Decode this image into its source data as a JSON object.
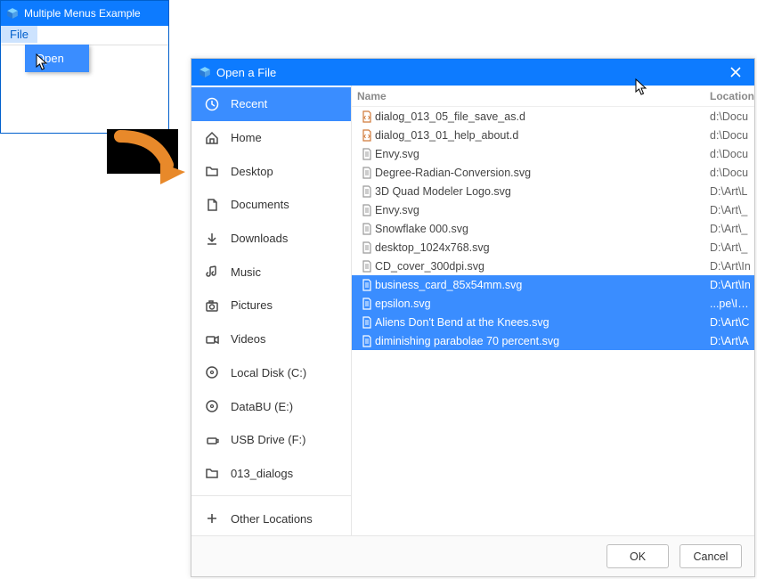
{
  "app": {
    "title": "Multiple Menus Example",
    "menu_file": "File",
    "menu_open": "Open"
  },
  "dialog": {
    "title": "Open a File",
    "header": {
      "name": "Name",
      "location": "Location"
    },
    "sidebar": [
      {
        "label": "Recent",
        "icon": "clock-icon",
        "selected": true
      },
      {
        "label": "Home",
        "icon": "home-icon",
        "selected": false
      },
      {
        "label": "Desktop",
        "icon": "folder-icon",
        "selected": false
      },
      {
        "label": "Documents",
        "icon": "document-icon",
        "selected": false
      },
      {
        "label": "Downloads",
        "icon": "download-icon",
        "selected": false
      },
      {
        "label": "Music",
        "icon": "music-icon",
        "selected": false
      },
      {
        "label": "Pictures",
        "icon": "camera-icon",
        "selected": false
      },
      {
        "label": "Videos",
        "icon": "video-icon",
        "selected": false
      },
      {
        "label": "Local Disk (C:)",
        "icon": "disk-icon",
        "selected": false
      },
      {
        "label": "DataBU (E:)",
        "icon": "disk-icon",
        "selected": false
      },
      {
        "label": "USB Drive (F:)",
        "icon": "usb-icon",
        "selected": false
      },
      {
        "label": "013_dialogs",
        "icon": "folder-icon",
        "selected": false
      }
    ],
    "other_locations": "Other Locations",
    "files": [
      {
        "name": "dialog_013_05_file_save_as.d",
        "location": "d:\\Docu",
        "selected": false,
        "kind": "code"
      },
      {
        "name": "dialog_013_01_help_about.d",
        "location": "d:\\Docu",
        "selected": false,
        "kind": "code"
      },
      {
        "name": "Envy.svg",
        "location": "d:\\Docu",
        "selected": false,
        "kind": "doc"
      },
      {
        "name": "Degree-Radian-Conversion.svg",
        "location": "d:\\Docu",
        "selected": false,
        "kind": "doc"
      },
      {
        "name": "3D Quad Modeler Logo.svg",
        "location": "D:\\Art\\L",
        "selected": false,
        "kind": "doc"
      },
      {
        "name": "Envy.svg",
        "location": "D:\\Art\\_",
        "selected": false,
        "kind": "doc"
      },
      {
        "name": "Snowflake 000.svg",
        "location": "D:\\Art\\_",
        "selected": false,
        "kind": "doc"
      },
      {
        "name": "desktop_1024x768.svg",
        "location": "D:\\Art\\_",
        "selected": false,
        "kind": "doc"
      },
      {
        "name": "CD_cover_300dpi.svg",
        "location": "D:\\Art\\In",
        "selected": false,
        "kind": "doc"
      },
      {
        "name": "business_card_85x54mm.svg",
        "location": "D:\\Art\\In",
        "selected": true,
        "kind": "doc"
      },
      {
        "name": "epsilon.svg",
        "location": "...pe\\Inks",
        "selected": true,
        "kind": "doc"
      },
      {
        "name": "Aliens Don't Bend at the Knees.svg",
        "location": "D:\\Art\\C",
        "selected": true,
        "kind": "doc"
      },
      {
        "name": "diminishing parabolae 70 percent.svg",
        "location": "D:\\Art\\A",
        "selected": true,
        "kind": "doc"
      }
    ],
    "buttons": {
      "ok": "OK",
      "cancel": "Cancel"
    }
  }
}
